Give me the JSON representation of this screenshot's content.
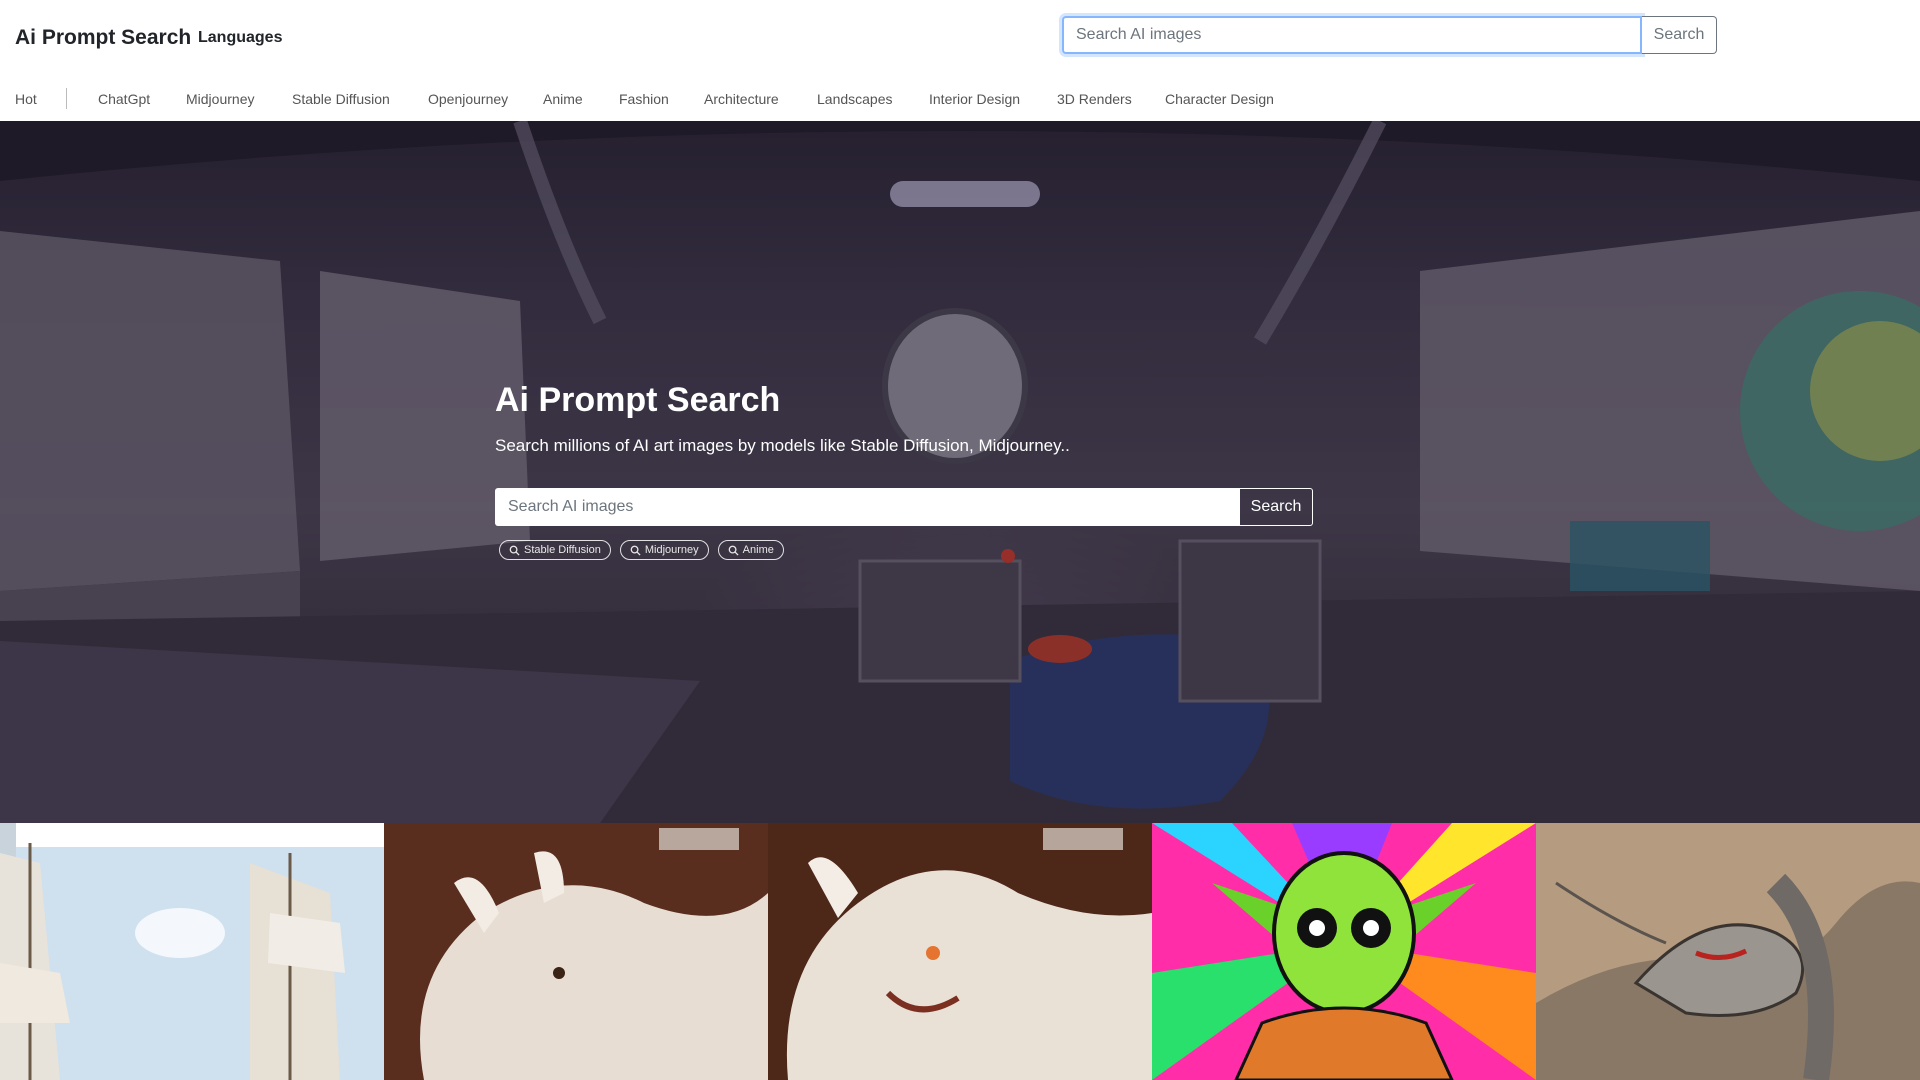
{
  "header": {
    "brand": "Ai Prompt Search",
    "languages_label": "Languages",
    "search": {
      "placeholder": "Search AI images",
      "button_label": "Search"
    }
  },
  "categories": [
    "Hot",
    "ChatGpt",
    "Midjourney",
    "Stable Diffusion",
    "Openjourney",
    "Anime",
    "Fashion",
    "Architecture",
    "Landscapes",
    "Interior Design",
    "3D Renders",
    "Character Design"
  ],
  "hero": {
    "title": "Ai Prompt Search",
    "subtitle": "Search millions of AI art images by models like Stable Diffusion, Midjourney..",
    "search": {
      "placeholder": "Search AI images",
      "button_label": "Search"
    },
    "chips": [
      "Stable Diffusion",
      "Midjourney",
      "Anime"
    ]
  },
  "gallery": {
    "tiles": [
      {
        "subject": "sailing ships under blue sky"
      },
      {
        "subject": "white triceratops-like creature sculpture"
      },
      {
        "subject": "white horned creature sculpture"
      },
      {
        "subject": "psychedelic yoda-like character"
      },
      {
        "subject": "silver dragon"
      }
    ]
  },
  "colors": {
    "focus_border": "#86b7fe",
    "nav_text": "#555555",
    "hero_text": "#ffffff"
  }
}
